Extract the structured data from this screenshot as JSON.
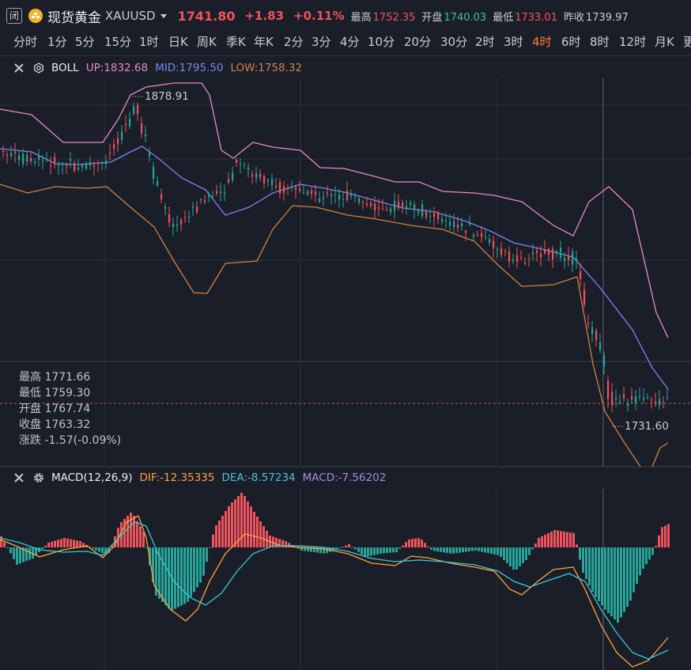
{
  "header": {
    "close_label": "闭",
    "title": "现货黄金",
    "code": "XAUUSD",
    "price": "1741.80",
    "change": "+1.83",
    "change_pct": "+0.11%",
    "high_label": "最高",
    "high_value": "1752.35",
    "open_label": "开盘",
    "open_value": "1740.03",
    "low_label": "最低",
    "low_value": "1733.01",
    "prev_close_label": "昨收",
    "prev_close_value": "1739.97"
  },
  "periods": [
    "分时",
    "1分",
    "5分",
    "15分",
    "1时",
    "日K",
    "周K",
    "季K",
    "年K",
    "2分",
    "3分",
    "4分",
    "10分",
    "20分",
    "30分",
    "2时",
    "3时",
    "4时",
    "6时",
    "8时",
    "12时",
    "月K",
    "更"
  ],
  "active_period": "4时",
  "boll": {
    "name": "BOLL",
    "up": "UP:1832.68",
    "mid": "MID:1795.50",
    "low": "LOW:1758.32"
  },
  "macd": {
    "name": "MACD(12,26,9)",
    "dif": "DIF:-12.35335",
    "dea": "DEA:-8.57234",
    "macd": "MACD:-7.56202"
  },
  "crosshair_info": {
    "high": "最高 1771.66",
    "low": "最低 1759.30",
    "open": "开盘 1767.74",
    "close": "收盘 1763.32",
    "change": "涨跌 -1.57(-0.09%)"
  },
  "max_label": "1878.91",
  "min_label": "1731.60",
  "colors": {
    "up": "#f0535d",
    "down": "#26a69a",
    "active": "#ff7a2f",
    "boll_up": "#e889c8",
    "boll_mid": "#7b86ef",
    "boll_low": "#d08242",
    "dif": "#ffa33a",
    "dea": "#3cc8dc"
  }
}
